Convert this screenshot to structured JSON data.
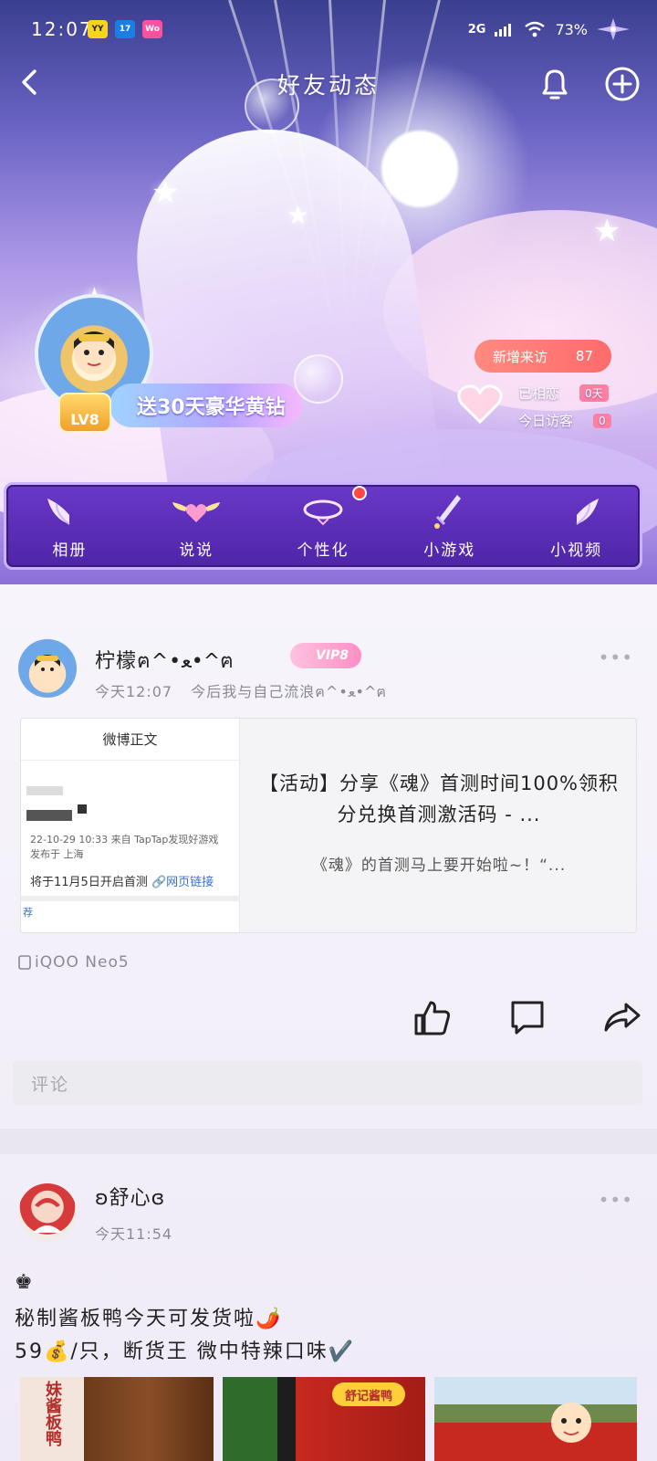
{
  "status_bar": {
    "time": "12:07",
    "network": "2G",
    "battery": "73%",
    "apps": [
      {
        "label": "YY",
        "bg": "#f7d51c",
        "fg": "#222"
      },
      {
        "label": "17",
        "bg": "#1a7ee6",
        "fg": "#fff"
      },
      {
        "label": "Wo",
        "bg": "#ff4fa0",
        "fg": "#fff"
      }
    ]
  },
  "header": {
    "title": "好友动态",
    "back_icon": "chevron-left-icon",
    "bell_icon": "bell-icon",
    "add_icon": "plus-circle-icon"
  },
  "profile": {
    "level": "LV8",
    "promo": "送30天豪华黄钻",
    "new_visitors_label": "新增来访",
    "new_visitors_count": "87",
    "days_label": "已相恋",
    "days_value": "0天",
    "today_visitors_label": "今日访客",
    "today_visitors_value": "0"
  },
  "features": [
    {
      "label": "相册",
      "icon": "angel-wings-icon"
    },
    {
      "label": "说说",
      "icon": "heart-wings-icon"
    },
    {
      "label": "个性化",
      "icon": "halo-ring-icon"
    },
    {
      "label": "小游戏",
      "icon": "sword-icon"
    },
    {
      "label": "小视频",
      "icon": "feather-wings-icon"
    }
  ],
  "post1": {
    "name": "柠檬ฅ^•ﻌ•^ฅ",
    "vip": "VIP8",
    "time": "今天12:07",
    "status": "今后我与自己流浪ฅ^•ﻌ•^ฅ",
    "share": {
      "thumb_header": "微博正文",
      "thumb_meta": "22-10-29 10:33  来自 TapTap发现好游戏",
      "thumb_loc": "发布于 上海",
      "thumb_text": "将于11月5日开启首测",
      "thumb_link": "网页链接",
      "thumb_tail": "荐",
      "title": "【活动】分享《魂》首测时间100%领积分兑换首测激活码 - ...",
      "desc": "《魂》的首测马上要开始啦~！“..."
    },
    "device": "iQOO Neo5",
    "comment_placeholder": "评论"
  },
  "post2": {
    "name": "ʚ舒心ɞ",
    "time": "今天11:54",
    "line1": "♚",
    "line2": "秘制酱板鸭今天可发货啦🌶️",
    "line3": "59💰/只，断货王 微中特辣口味✔️",
    "photo1_text": "妹酱板鸭",
    "photo2_text": "舒记酱鸭"
  }
}
